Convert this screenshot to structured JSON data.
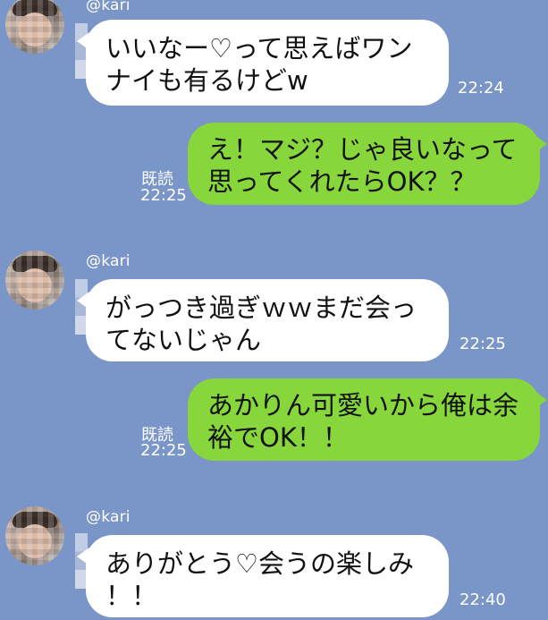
{
  "colors": {
    "background": "#7a95c8",
    "incoming_bubble": "#ffffff",
    "outgoing_bubble": "#86d63c",
    "meta_text": "#ffffff"
  },
  "messages": [
    {
      "type": "incoming",
      "username": "@kari",
      "text": "いいなー♡って思えばワン\nナイも有るけどw",
      "time": "22:24"
    },
    {
      "type": "outgoing",
      "text": "え！マジ？じゃ良いなって\n思ってくれたらOK？？",
      "read": "既読",
      "time": "22:25"
    },
    {
      "type": "incoming",
      "username": "@kari",
      "text": "がっつき過ぎｗｗまだ会っ\nてないじゃん",
      "time": "22:25"
    },
    {
      "type": "outgoing",
      "text": "あかりん可愛いから俺は余\n裕でOK！！",
      "read": "既読",
      "time": "22:25"
    },
    {
      "type": "incoming",
      "username": "@kari",
      "text": "ありがとう♡会うの楽しみ\n！！",
      "time": "22:40"
    }
  ]
}
